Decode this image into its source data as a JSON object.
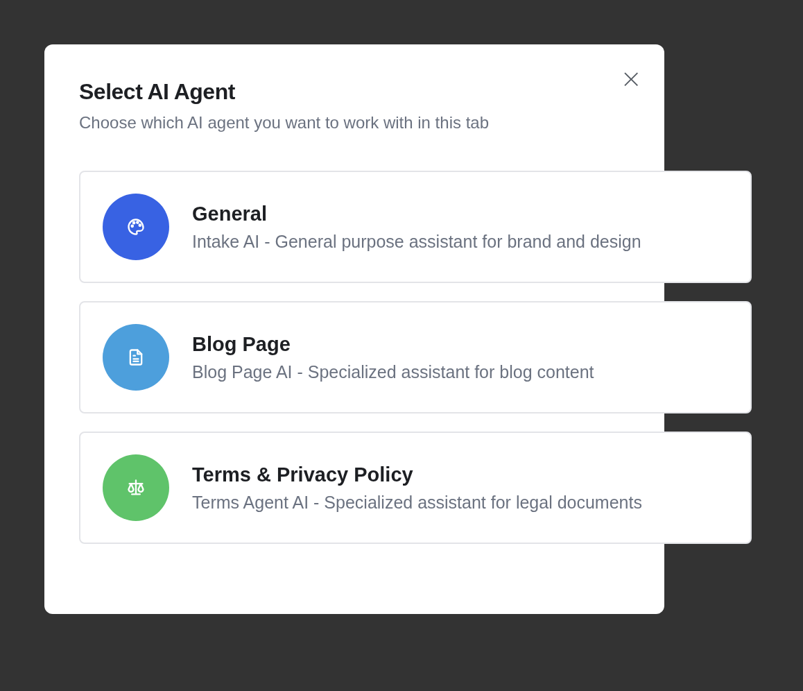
{
  "dialog": {
    "title": "Select AI Agent",
    "subtitle": "Choose which AI agent you want to work with in this tab",
    "close": "×"
  },
  "agents": [
    {
      "name": "General",
      "description": "Intake AI - General purpose assistant for brand and design",
      "kind": "palette",
      "color": "#3862e3"
    },
    {
      "name": "Blog Page",
      "description": "Blog Page AI - Specialized assistant for blog content",
      "kind": "document",
      "color": "#4d9fdc"
    },
    {
      "name": "Terms & Privacy Policy",
      "description": "Terms Agent AI - Specialized assistant for legal documents",
      "kind": "scale",
      "color": "#5fc36a"
    }
  ]
}
